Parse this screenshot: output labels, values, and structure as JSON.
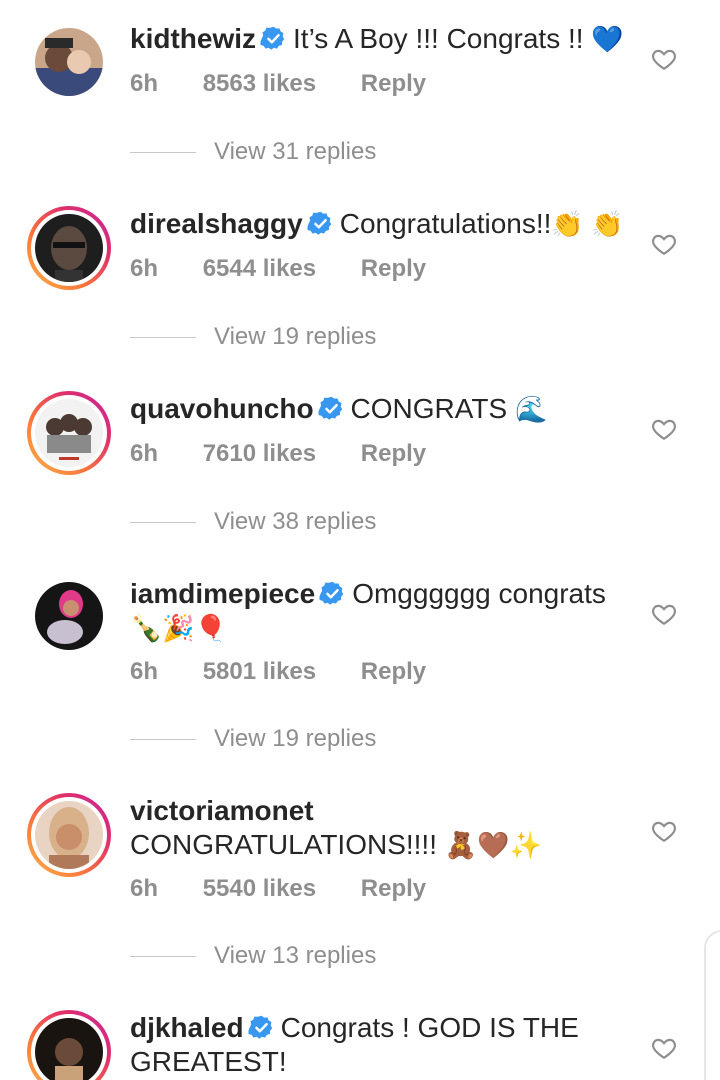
{
  "comments": [
    {
      "username": "kidthewiz",
      "verified": true,
      "text": "It’s A Boy !!! Congrats !!",
      "emoji": "💙",
      "time": "6h",
      "likes": "8563 likes",
      "reply": "Reply",
      "view_replies": "View 31 replies"
    },
    {
      "username": "direalshaggy",
      "verified": true,
      "text": "Congratulations!!",
      "emoji": "👏 👏",
      "time": "6h",
      "likes": "6544 likes",
      "reply": "Reply",
      "view_replies": "View 19 replies"
    },
    {
      "username": "quavohuncho",
      "verified": true,
      "text": "CONGRATS",
      "emoji": "🌊",
      "time": "6h",
      "likes": "7610 likes",
      "reply": "Reply",
      "view_replies": "View 38 replies"
    },
    {
      "username": "iamdimepiece",
      "verified": true,
      "text": "Omgggggg congrats",
      "emoji": "🍾🎉🎈",
      "time": "6h",
      "likes": "5801 likes",
      "reply": "Reply",
      "view_replies": "View 19 replies"
    },
    {
      "username": "victoriamonet",
      "verified": false,
      "text": "CONGRATULATIONS!!!!",
      "emoji": "🧸🤎✨",
      "time": "6h",
      "likes": "5540 likes",
      "reply": "Reply",
      "view_replies": "View 13 replies"
    },
    {
      "username": "djkhaled",
      "verified": true,
      "text": "Congrats ! GOD IS THE GREATEST!",
      "emoji": ""
    }
  ],
  "colors": {
    "verified_blue": "#3897f0",
    "meta_gray": "#8e8e8e",
    "text": "#262626"
  },
  "icons": {
    "verified": "verified-badge-icon",
    "like": "heart-outline-icon"
  }
}
